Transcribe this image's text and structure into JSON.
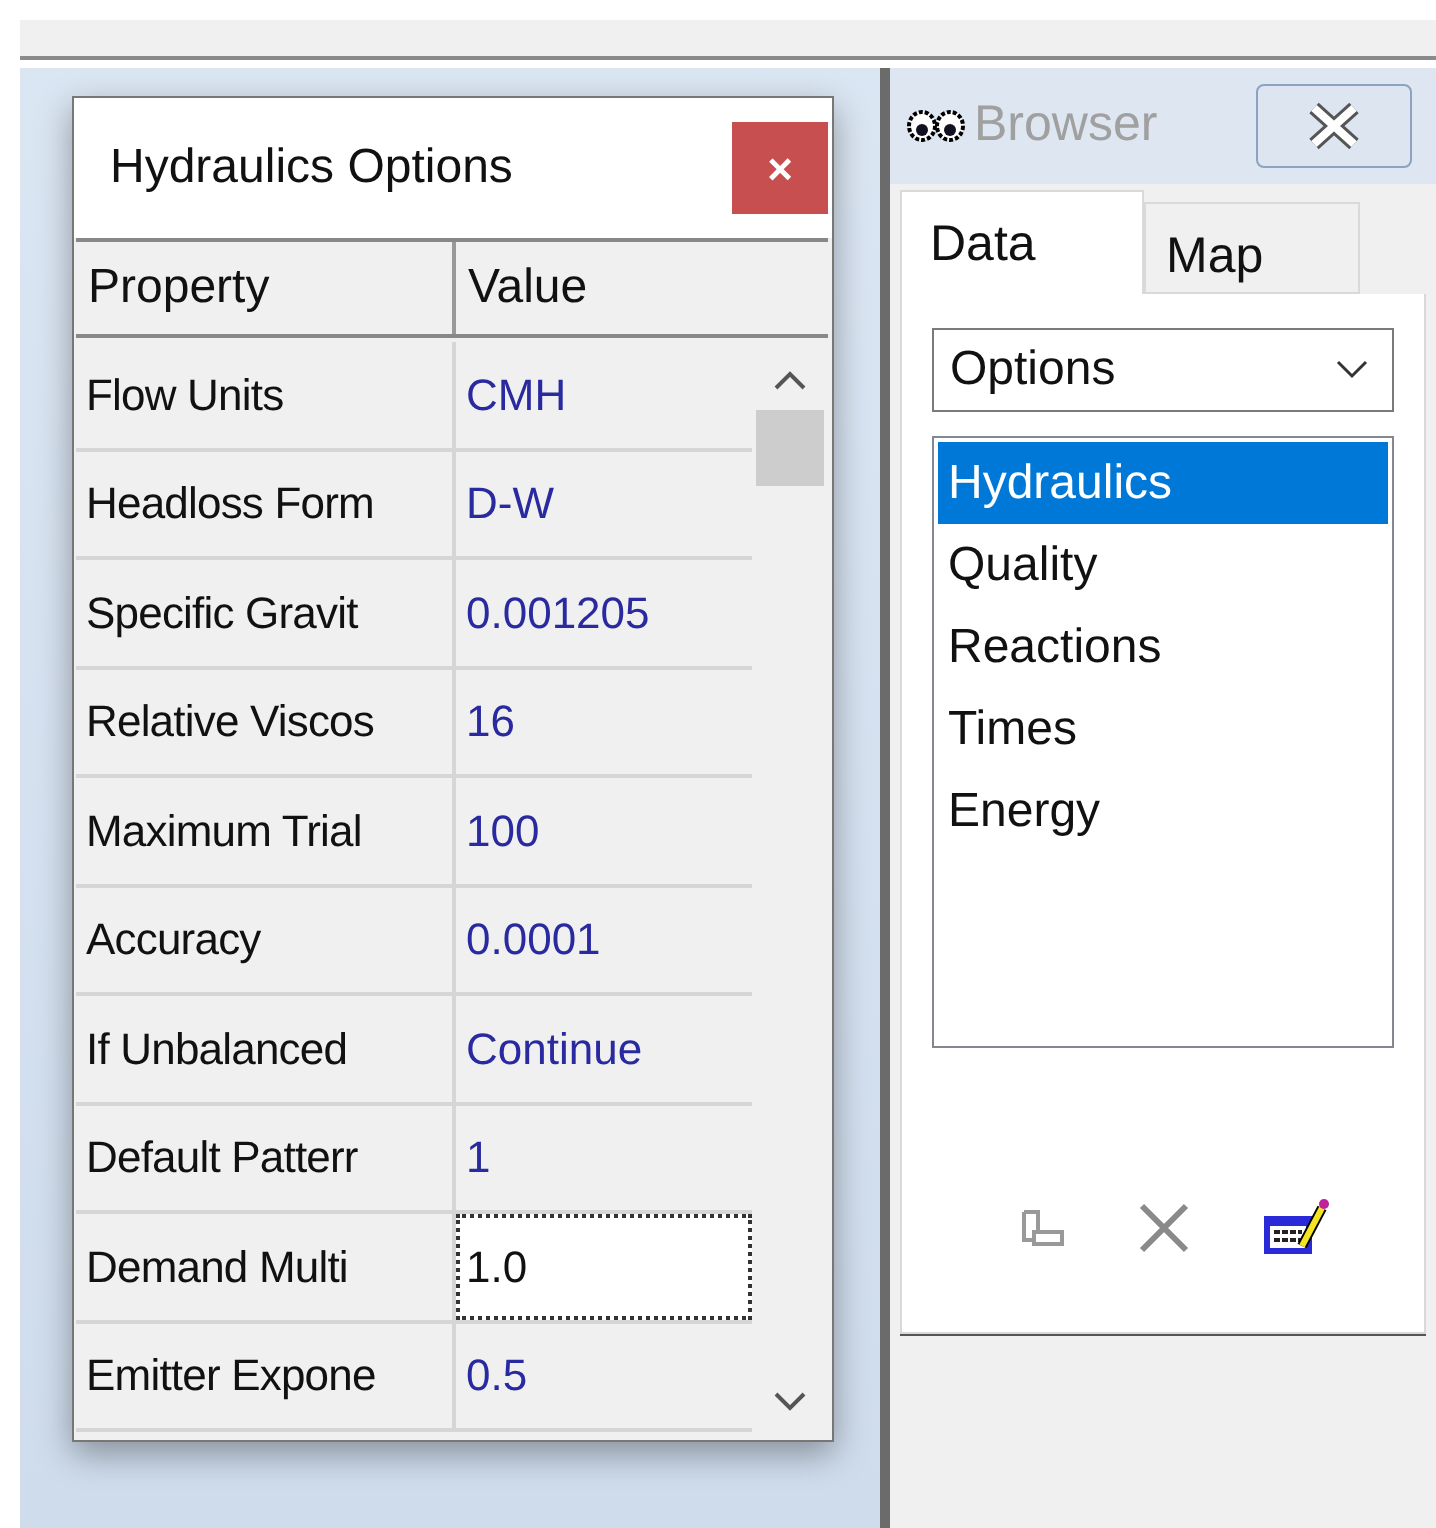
{
  "dialog": {
    "title": "Hydraulics Options",
    "close": "×",
    "columns": [
      "Property",
      "Value"
    ],
    "rows": [
      {
        "property": "Flow Units",
        "value": "CMH",
        "selected": false
      },
      {
        "property": "Headloss Form",
        "value": "D-W",
        "selected": false
      },
      {
        "property": "Specific Gravit",
        "value": "0.001205",
        "selected": false
      },
      {
        "property": "Relative Viscos",
        "value": "16",
        "selected": false
      },
      {
        "property": "Maximum Trial",
        "value": "100",
        "selected": false
      },
      {
        "property": "Accuracy",
        "value": "0.0001",
        "selected": false
      },
      {
        "property": "If Unbalanced",
        "value": "Continue",
        "selected": false
      },
      {
        "property": "Default Patterr",
        "value": "1",
        "selected": false
      },
      {
        "property": "Demand Multi",
        "value": "1.0",
        "selected": true
      },
      {
        "property": "Emitter Expone",
        "value": "0.5",
        "selected": false
      }
    ]
  },
  "browser": {
    "title": "Browser",
    "tabs": [
      {
        "label": "Data",
        "selected": true
      },
      {
        "label": "Map",
        "selected": false
      }
    ],
    "dropdown": {
      "value": "Options"
    },
    "items": [
      {
        "label": "Hydraulics",
        "selected": true
      },
      {
        "label": "Quality",
        "selected": false
      },
      {
        "label": "Reactions",
        "selected": false
      },
      {
        "label": "Times",
        "selected": false
      },
      {
        "label": "Energy",
        "selected": false
      }
    ]
  }
}
